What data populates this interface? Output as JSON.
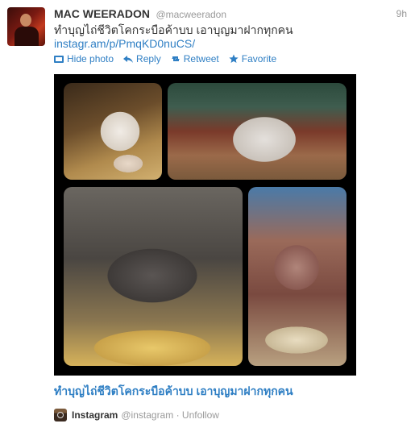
{
  "tweet": {
    "fullname": "MAC WEERADON",
    "username": "@macweeradon",
    "time": "9h",
    "text": "ทำบุญไถ่ชีวิตโคกระบือค้าบบ เอาบุญมาฝากทุกคน",
    "link": "instagr.am/p/PmqKD0nuCS/"
  },
  "actions": {
    "hide_photo": "Hide photo",
    "reply": "Reply",
    "retweet": "Retweet",
    "favorite": "Favorite"
  },
  "media": {
    "caption": "ทำบุญไถ่ชีวิตโคกระบือค้าบบ เอาบุญมาฝากทุกคน"
  },
  "source": {
    "name": "Instagram",
    "handle": "@instagram",
    "unfollow": "· Unfollow"
  }
}
